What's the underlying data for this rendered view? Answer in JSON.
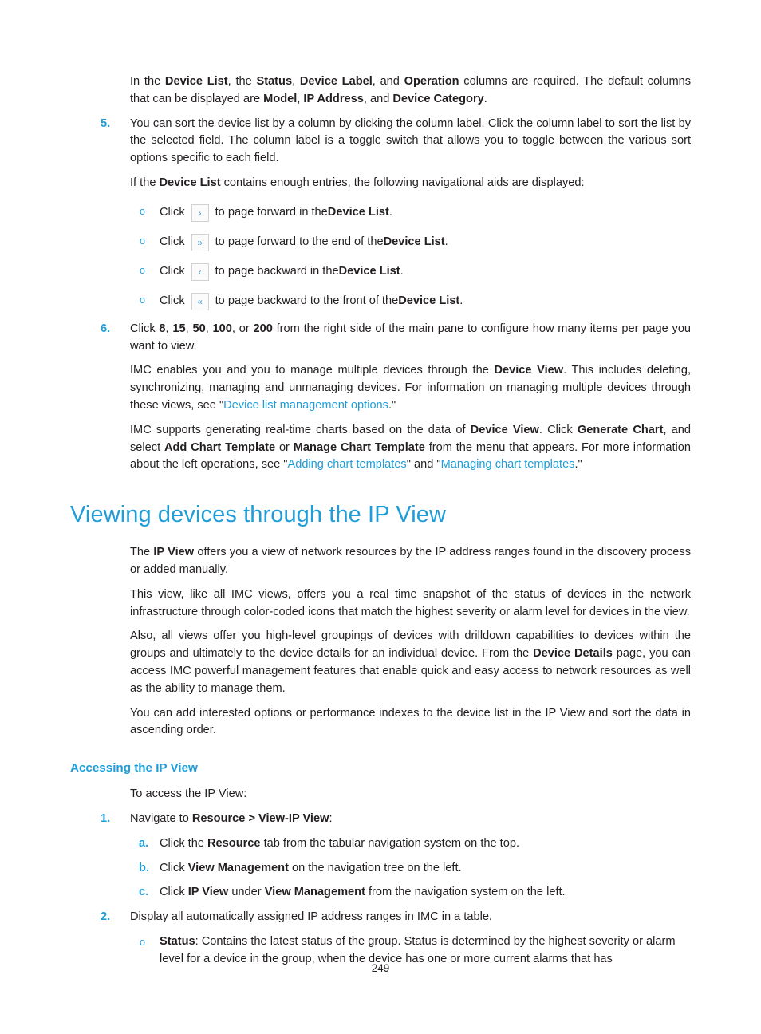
{
  "page": {
    "number": "249",
    "accent_color": "#1F9DD9",
    "text_color": "#231F20"
  },
  "intro_paragraph": {
    "s1": "In the ",
    "b1": "Device List",
    "s2": ", the ",
    "b2": "Status",
    "s3": ", ",
    "b3": "Device Label",
    "s4": ", and ",
    "b4": "Operation",
    "s5": " columns are required. The default columns that can be displayed are ",
    "b5": "Model",
    "s6": ", ",
    "b6": "IP Address",
    "s7": ", and ",
    "b7": "Device Category",
    "s8": "."
  },
  "step5": {
    "marker": "5.",
    "text": "You can sort the device list by a column by clicking the column label. Click the column label to sort the list by the selected field. The column label is a toggle switch that allows you to toggle between the various sort options specific to each field."
  },
  "nav_aids_intro": {
    "s1": "If the ",
    "b1": "Device List",
    "s2": " contains enough entries, the following navigational aids are displayed:"
  },
  "nav_aids": {
    "bullet": "o",
    "items": [
      {
        "click_label": "Click",
        "icon": "chevron-right-icon",
        "glyph": "›",
        "text_before": " to page forward in the ",
        "bold": "Device List",
        "text_after": "."
      },
      {
        "click_label": "Click",
        "icon": "chevron-double-right-icon",
        "glyph": "»",
        "text_before": " to page forward to the end of the ",
        "bold": "Device List",
        "text_after": "."
      },
      {
        "click_label": "Click",
        "icon": "chevron-left-icon",
        "glyph": "‹",
        "text_before": " to page backward in the ",
        "bold": "Device List",
        "text_after": "."
      },
      {
        "click_label": "Click",
        "icon": "chevron-double-left-icon",
        "glyph": "«",
        "text_before": " to page backward to the front of the ",
        "bold": "Device List",
        "text_after": "."
      }
    ]
  },
  "step6": {
    "marker": "6.",
    "s1": "Click ",
    "b1": "8",
    "s2": ", ",
    "b2": "15",
    "s3": ", ",
    "b3": "50",
    "s4": ", ",
    "b4": "100",
    "s5": ", or ",
    "b5": "200",
    "s6": " from the right side of the main pane to configure how many items per page you want to view."
  },
  "device_view_para": {
    "s1": "IMC enables you and you to manage multiple devices through the ",
    "b1": "Device View",
    "s2": ". This includes deleting, synchronizing, managing and unmanaging devices. For information on managing multiple devices through these views, see \"",
    "link1": "Device list management options",
    "s3": ".\""
  },
  "charts_para": {
    "s1": "IMC supports generating real-time charts based on the data of ",
    "b1": "Device View",
    "s2": ". Click ",
    "b2": "Generate Chart",
    "s3": ", and select ",
    "b3": "Add Chart Template",
    "s4": " or ",
    "b4": "Manage Chart Template",
    "s5": " from the menu that appears. For more information about the left operations, see \"",
    "link1": "Adding chart templates",
    "s6": "\" and \"",
    "link2": "Managing chart templates",
    "s7": ".\""
  },
  "heading1": "Viewing devices through the IP View",
  "ip_view_para1": {
    "s1": "The ",
    "b1": "IP View",
    "s2": " offers you a view of network resources by the IP address ranges found in the discovery process or added manually."
  },
  "ip_view_para2": "This view, like all IMC views, offers you a real time snapshot of the status of devices in the network infrastructure through color-coded icons that match the highest severity or alarm level for devices in the view.",
  "ip_view_para3": {
    "s1": "Also, all views offer you high-level groupings of devices with drilldown capabilities to devices within the groups and ultimately to the device details for an individual device. From the ",
    "b1": "Device Details",
    "s2": " page, you can access IMC powerful management features that enable quick and easy access to network resources as well as the ability to manage them."
  },
  "ip_view_para4": "You can add interested options or performance indexes to the device list in the IP View and sort the data in ascending order.",
  "heading2": "Accessing the IP View",
  "access_intro": "To access the IP View:",
  "access_step1": {
    "marker": "1.",
    "s1": "Navigate to ",
    "b1": "Resource > View-IP View",
    "s2": ":"
  },
  "access_substeps": [
    {
      "marker": "a.",
      "s1": "Click the ",
      "b1": "Resource",
      "s2": " tab from the tabular navigation system on the top.",
      "b2": "",
      "s3": ""
    },
    {
      "marker": "b.",
      "s1": "Click ",
      "b1": "View Management",
      "s2": " on the navigation tree on the left.",
      "b2": "",
      "s3": ""
    },
    {
      "marker": "c.",
      "s1": "Click ",
      "b1": "IP View",
      "s2": " under ",
      "b2": "View Management",
      "s3": " from the navigation system on the left."
    }
  ],
  "access_step2": {
    "marker": "2.",
    "text": "Display all automatically assigned IP address ranges in IMC in a table."
  },
  "status_bullet": {
    "bullet": "o",
    "b1": "Status",
    "s1": ": Contains the latest status of the group. Status is determined by the highest severity or alarm level for a device in the group, when the device has one or more current alarms that has"
  }
}
